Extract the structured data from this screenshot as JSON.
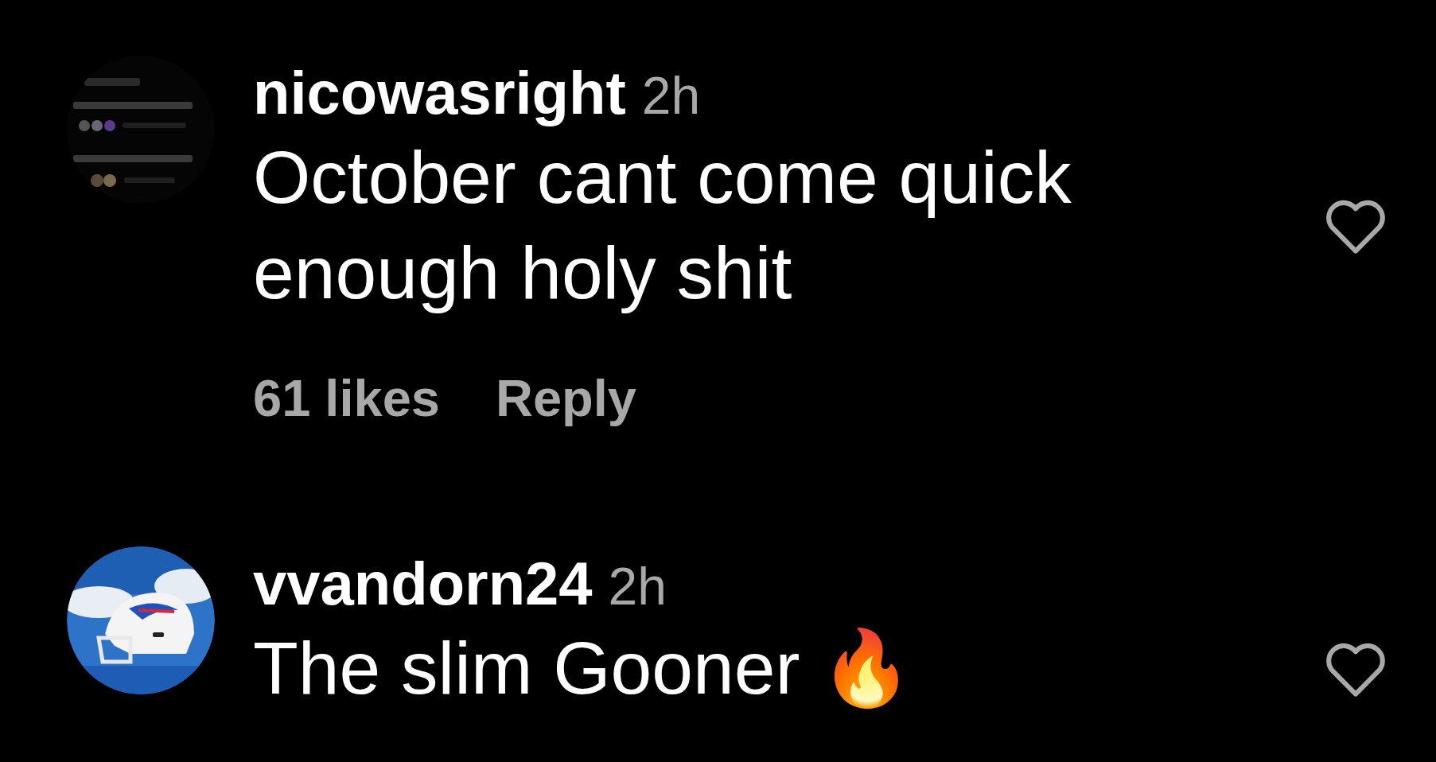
{
  "comments": [
    {
      "avatar": {
        "kind": "picture"
      },
      "username": "nicowasright",
      "time": "2h",
      "lines": [
        "October cant come quick",
        "enough holy shit"
      ],
      "likes": "61 likes",
      "reply": "Reply"
    },
    {
      "avatar": {
        "kind": "picture"
      },
      "username": "vvandorn24",
      "time": "2h",
      "lines": [
        "The slim Gooner 🔥"
      ]
    }
  ]
}
